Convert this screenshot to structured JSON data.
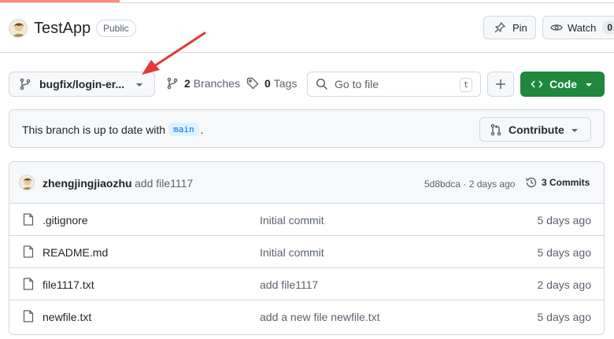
{
  "repo": {
    "name": "TestApp",
    "visibility": "Public"
  },
  "header_actions": {
    "pin_label": "Pin",
    "watch_label": "Watch",
    "watch_count": "0"
  },
  "toolbar": {
    "branch_name": "bugfix/login-er...",
    "branches_count": "2",
    "branches_label": "Branches",
    "tags_count": "0",
    "tags_label": "Tags",
    "goto_placeholder": "Go to file",
    "goto_shortcut": "t",
    "code_label": "Code"
  },
  "status": {
    "text_prefix": "This branch is up to date with",
    "base_branch": "main",
    "text_suffix": ".",
    "contribute_label": "Contribute"
  },
  "latest_commit": {
    "author": "zhengjingjiaozhu",
    "message": "add file1117",
    "meta": "5d8bdca · 2 days ago",
    "commits_label": "3 Commits"
  },
  "files": [
    {
      "name": ".gitignore",
      "commit": "Initial commit",
      "date": "5 days ago"
    },
    {
      "name": "README.md",
      "commit": "Initial commit",
      "date": "5 days ago"
    },
    {
      "name": "file1117.txt",
      "commit": "add file1117",
      "date": "2 days ago"
    },
    {
      "name": "newfile.txt",
      "commit": "add a new file newfile.txt",
      "date": "5 days ago"
    }
  ],
  "colors": {
    "accent_tab": "#fd8c73",
    "code_button": "#1f883d",
    "annotation_arrow": "#e53935",
    "chip_bg": "#ddf4ff",
    "chip_text": "#0969da"
  },
  "icons": {
    "pin": "pin-icon",
    "watch": "eye-icon",
    "branch": "git-branch-icon",
    "tag": "tag-icon",
    "search": "search-icon",
    "plus": "plus-icon",
    "code": "code-icon",
    "contribute": "git-pull-request-icon",
    "history": "history-icon",
    "file": "file-icon"
  }
}
